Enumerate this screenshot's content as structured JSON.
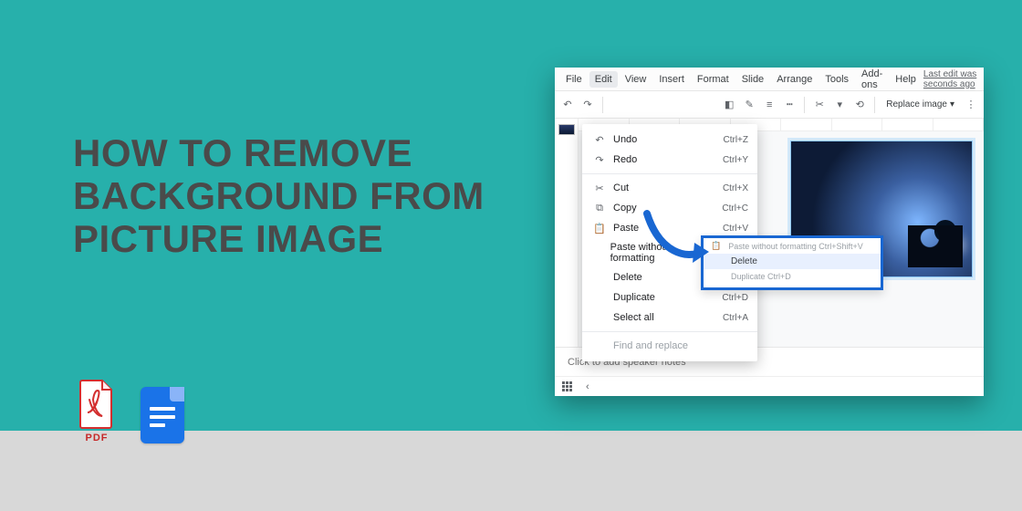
{
  "title": "HOW TO REMOVE BACKGROUND FROM PICTURE IMAGE",
  "pdf_label": "PDF",
  "menubar": {
    "items": [
      "File",
      "Edit",
      "View",
      "Insert",
      "Format",
      "Slide",
      "Arrange",
      "Tools",
      "Add-ons",
      "Help"
    ],
    "active_index": 1,
    "last_edit": "Last edit was seconds ago"
  },
  "toolbar": {
    "replace_label": "Replace image"
  },
  "dropdown": {
    "items": [
      {
        "icon": "undo",
        "label": "Undo",
        "shortcut": "Ctrl+Z"
      },
      {
        "icon": "redo",
        "label": "Redo",
        "shortcut": "Ctrl+Y"
      },
      {
        "div": true
      },
      {
        "icon": "cut",
        "label": "Cut",
        "shortcut": "Ctrl+X"
      },
      {
        "icon": "copy",
        "label": "Copy",
        "shortcut": "Ctrl+C"
      },
      {
        "icon": "paste",
        "label": "Paste",
        "shortcut": "Ctrl+V"
      },
      {
        "icon": "",
        "label": "Paste without formatting",
        "shortcut": "Ctrl+Shift+V"
      },
      {
        "icon": "",
        "label": "Delete",
        "shortcut": ""
      },
      {
        "icon": "",
        "label": "Duplicate",
        "shortcut": "Ctrl+D"
      },
      {
        "icon": "",
        "label": "Select all",
        "shortcut": "Ctrl+A"
      },
      {
        "div": true
      },
      {
        "icon": "",
        "label": "Find and replace",
        "shortcut": "",
        "faint": true
      }
    ]
  },
  "zoombox": {
    "top": "Paste without formatting    Ctrl+Shift+V",
    "highlight": "Delete",
    "bottom": "Duplicate                          Ctrl+D"
  },
  "notes_placeholder": "Click to add speaker notes"
}
